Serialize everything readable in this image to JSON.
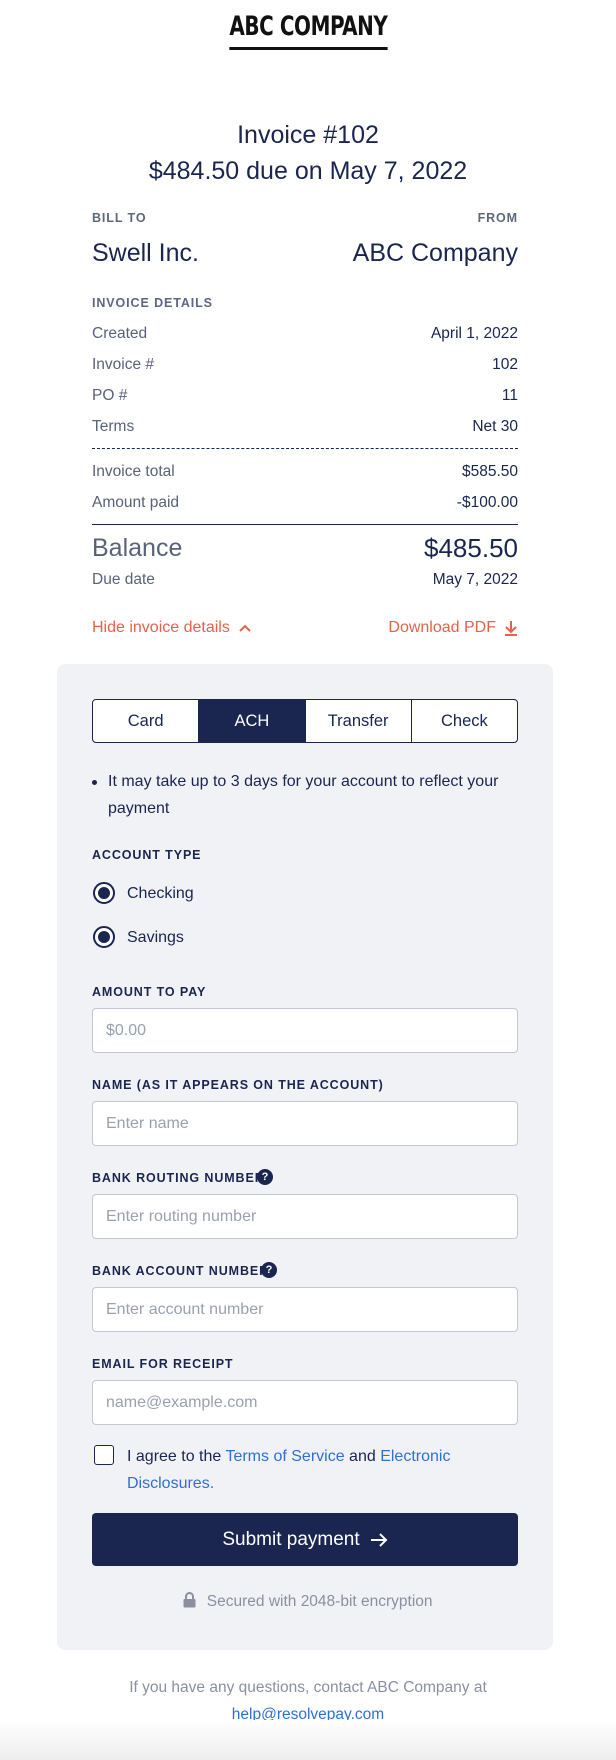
{
  "brand": {
    "logo_text": "ABC COMPANY"
  },
  "invoice": {
    "title": "Invoice #102",
    "due_line": "$484.50 due on May 7, 2022"
  },
  "parties": {
    "bill_to_label": "BILL TO",
    "bill_to_name": "Swell Inc.",
    "from_label": "FROM",
    "from_name": "ABC Company"
  },
  "details": {
    "heading": "INVOICE DETAILS",
    "rows": [
      {
        "label": "Created",
        "value": "April 1, 2022"
      },
      {
        "label": "Invoice #",
        "value": "102"
      },
      {
        "label": "PO #",
        "value": "11"
      },
      {
        "label": "Terms",
        "value": "Net 30"
      }
    ],
    "totals": [
      {
        "label": "Invoice total",
        "value": "$585.50"
      },
      {
        "label": "Amount paid",
        "value": "-$100.00"
      }
    ],
    "balance_label": "Balance",
    "balance_value": "$485.50",
    "due_date_label": "Due date",
    "due_date_value": "May 7, 2022"
  },
  "actions": {
    "hide_details": "Hide invoice details",
    "download_pdf": "Download PDF"
  },
  "payment": {
    "tabs": [
      {
        "label": "Card",
        "active": false
      },
      {
        "label": "ACH",
        "active": true
      },
      {
        "label": "Transfer",
        "active": false
      },
      {
        "label": "Check",
        "active": false
      }
    ],
    "note": "It may take up to 3 days for your account to reflect your payment",
    "account_type_label": "ACCOUNT TYPE",
    "account_types": [
      {
        "label": "Checking",
        "selected": true
      },
      {
        "label": "Savings",
        "selected": true
      }
    ],
    "amount_label": "AMOUNT TO PAY",
    "amount_placeholder": "$0.00",
    "name_label": "NAME (AS IT APPEARS ON THE ACCOUNT)",
    "name_placeholder": "Enter name",
    "routing_label": "BANK ROUTING NUMBER",
    "routing_placeholder": "Enter routing number",
    "account_label": "BANK ACCOUNT NUMBER",
    "account_placeholder": "Enter account number",
    "email_label": "EMAIL FOR RECEIPT",
    "email_placeholder": "name@example.com",
    "agree_prefix": "I agree to the",
    "terms_link": "Terms of Service",
    "agree_and": "and",
    "disclosures_link": "Electronic Disclosures.",
    "agree_checked": false,
    "submit_label": "Submit payment",
    "secure_text": "Secured with 2048-bit encryption",
    "help_glyph": "?"
  },
  "footer": {
    "text": "If you have any questions, contact ABC Company at",
    "email": "help@resolvepay.com"
  },
  "colors": {
    "navy": "#1a2550",
    "accent_orange": "#e5634a",
    "link_blue": "#2f6fd8",
    "panel_bg": "#f1f2f5"
  },
  "icons": {
    "hide_details": "chevron-up-icon",
    "download": "download-arrow-icon",
    "submit": "arrow-right-icon",
    "secure": "lock-icon",
    "help": "question-circle-icon"
  }
}
